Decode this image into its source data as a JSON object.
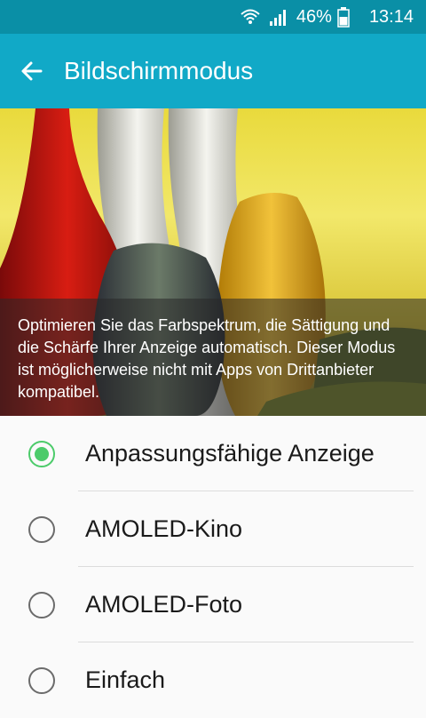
{
  "status_bar": {
    "wifi_icon": "wifi-icon",
    "signal_icon": "signal-icon",
    "battery_icon": "battery-icon",
    "battery_percent": "46%",
    "time": "13:14"
  },
  "app_bar": {
    "back_icon": "back-arrow-icon",
    "title": "Bildschirmmodus"
  },
  "hero": {
    "caption": "Optimieren Sie das Farbspektrum, die Sättigung und die Schärfe Ihrer Anzeige automatisch. Dieser Modus ist möglicherweise nicht mit Apps von Drittanbieter kompatibel."
  },
  "options": [
    {
      "label": "Anpassungsfähige Anzeige",
      "selected": true
    },
    {
      "label": "AMOLED-Kino",
      "selected": false
    },
    {
      "label": "AMOLED-Foto",
      "selected": false
    },
    {
      "label": "Einfach",
      "selected": false
    }
  ],
  "colors": {
    "status_bar": "#0a8fa6",
    "app_bar": "#11a9c7",
    "accent_selected": "#4ccb6a"
  }
}
